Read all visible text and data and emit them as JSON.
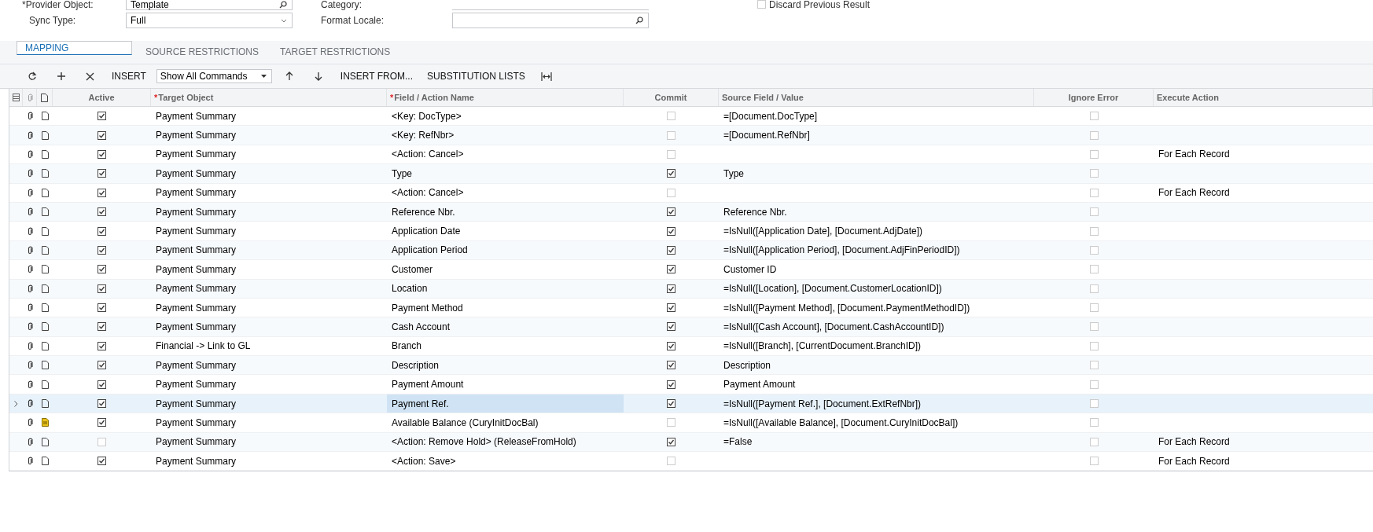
{
  "form": {
    "provider_object": {
      "label": "Provider Object:",
      "required_mark": "*",
      "value": "Template"
    },
    "sync_type": {
      "label": "Sync Type:",
      "value": "Full"
    },
    "category": {
      "label": "Category:"
    },
    "format_locale": {
      "label": "Format Locale:"
    },
    "discard_previous_result": {
      "label": "Discard Previous Result",
      "checked": false
    }
  },
  "tabs": [
    {
      "label": "MAPPING",
      "selected": true
    },
    {
      "label": "SOURCE RESTRICTIONS",
      "selected": false
    },
    {
      "label": "TARGET RESTRICTIONS",
      "selected": false
    }
  ],
  "toolbar": {
    "insert": "INSERT",
    "command_filter": "Show All Commands",
    "insert_from": "INSERT FROM...",
    "substitution_lists": "SUBSTITUTION LISTS"
  },
  "table": {
    "columns": [
      {
        "label": "Active",
        "kind": "checkbox"
      },
      {
        "label": "Target Object",
        "required_mark": "*",
        "kind": "text"
      },
      {
        "label": "Field / Action Name",
        "required_mark": "*",
        "kind": "text"
      },
      {
        "label": "Commit",
        "kind": "checkbox"
      },
      {
        "label": "Source Field / Value",
        "kind": "text"
      },
      {
        "label": "Ignore Error",
        "kind": "checkbox"
      },
      {
        "label": "Execute Action",
        "kind": "text"
      }
    ],
    "rows": [
      {
        "active": true,
        "target_object": "Payment Summary",
        "field": "<Key: DocType>",
        "commit": false,
        "source": "=[Document.DocType]",
        "ignore_error": false,
        "selected": false,
        "note": false
      },
      {
        "active": true,
        "target_object": "Payment Summary",
        "field": "<Key: RefNbr>",
        "commit": false,
        "source": "=[Document.RefNbr]",
        "ignore_error": false,
        "selected": false,
        "note": false
      },
      {
        "active": true,
        "target_object": "Payment Summary",
        "field": "<Action: Cancel>",
        "commit": false,
        "ignore_error": false,
        "execute_action": "For Each Record",
        "selected": false,
        "note": false
      },
      {
        "active": true,
        "target_object": "Payment Summary",
        "field": "Type",
        "commit": true,
        "source": "Type",
        "ignore_error": false,
        "selected": false,
        "note": false
      },
      {
        "active": true,
        "target_object": "Payment Summary",
        "field": "<Action: Cancel>",
        "commit": false,
        "ignore_error": false,
        "execute_action": "For Each Record",
        "selected": false,
        "note": false
      },
      {
        "active": true,
        "target_object": "Payment Summary",
        "field": "Reference Nbr.",
        "commit": true,
        "source": "Reference Nbr.",
        "ignore_error": false,
        "selected": false,
        "note": false
      },
      {
        "active": true,
        "target_object": "Payment Summary",
        "field": "Application Date",
        "commit": true,
        "source": "=IsNull([Application Date], [Document.AdjDate])",
        "ignore_error": false,
        "selected": false,
        "note": false
      },
      {
        "active": true,
        "target_object": "Payment Summary",
        "field": "Application Period",
        "commit": true,
        "source": "=IsNull([Application Period], [Document.AdjFinPeriodID])",
        "ignore_error": false,
        "selected": false,
        "note": false
      },
      {
        "active": true,
        "target_object": "Payment Summary",
        "field": "Customer",
        "commit": true,
        "source": "Customer ID",
        "ignore_error": false,
        "selected": false,
        "note": false
      },
      {
        "active": true,
        "target_object": "Payment Summary",
        "field": "Location",
        "commit": true,
        "source": "=IsNull([Location], [Document.CustomerLocationID])",
        "ignore_error": false,
        "selected": false,
        "note": false
      },
      {
        "active": true,
        "target_object": "Payment Summary",
        "field": "Payment Method",
        "commit": true,
        "source": "=IsNull([Payment Method], [Document.PaymentMethodID])",
        "ignore_error": false,
        "selected": false,
        "note": false
      },
      {
        "active": true,
        "target_object": "Payment Summary",
        "field": "Cash Account",
        "commit": true,
        "source": "=IsNull([Cash Account], [Document.CashAccountID])",
        "ignore_error": false,
        "selected": false,
        "note": false
      },
      {
        "active": true,
        "target_object": "Financial -> Link to GL",
        "field": "Branch",
        "commit": true,
        "source": "=IsNull([Branch], [CurrentDocument.BranchID])",
        "ignore_error": false,
        "selected": false,
        "note": false
      },
      {
        "active": true,
        "target_object": "Payment Summary",
        "field": "Description",
        "commit": true,
        "source": "Description",
        "ignore_error": false,
        "selected": false,
        "note": false
      },
      {
        "active": true,
        "target_object": "Payment Summary",
        "field": "Payment Amount",
        "commit": true,
        "source": "Payment Amount",
        "ignore_error": false,
        "selected": false,
        "note": false
      },
      {
        "active": true,
        "target_object": "Payment Summary",
        "field": "Payment Ref.",
        "commit": true,
        "source": "=IsNull([Payment Ref.], [Document.ExtRefNbr])",
        "ignore_error": false,
        "selected": true,
        "note": false
      },
      {
        "active": true,
        "target_object": "Payment Summary",
        "field": "Available Balance (CuryInitDocBal)",
        "commit": false,
        "source": "=IsNull([Available Balance], [Document.CuryInitDocBal])",
        "ignore_error": false,
        "selected": false,
        "note": true
      },
      {
        "active": false,
        "target_object": "Payment Summary",
        "field": "<Action: Remove Hold> (ReleaseFromHold)",
        "commit": true,
        "source": "=False",
        "ignore_error": false,
        "execute_action": "For Each Record",
        "selected": false,
        "note": false
      },
      {
        "active": true,
        "target_object": "Payment Summary",
        "field": "<Action: Save>",
        "commit": false,
        "ignore_error": false,
        "execute_action": "For Each Record",
        "selected": false,
        "note": false
      }
    ]
  }
}
